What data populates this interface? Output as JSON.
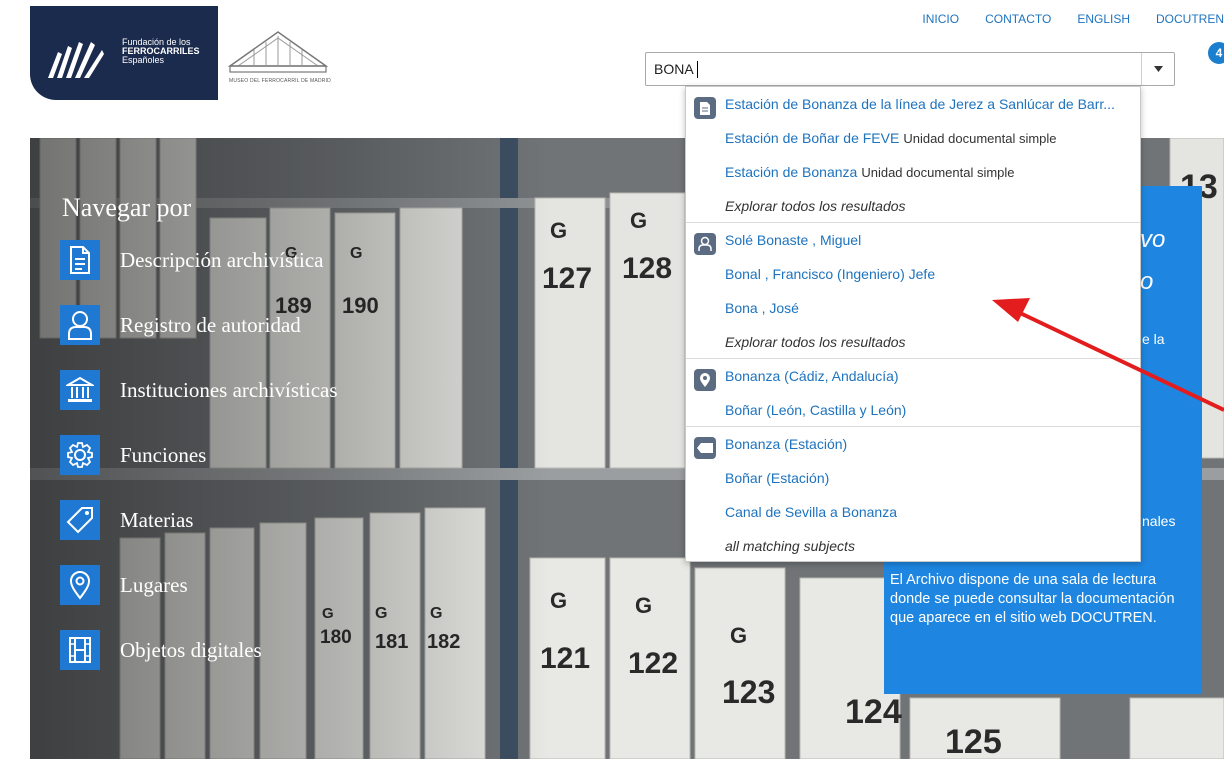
{
  "header": {
    "logo_line1": "Fundación de los",
    "logo_line2": "FERROCARRILES",
    "logo_line3": "Españoles",
    "museum_caption": "MUSEO DEL FERROCARRIL DE MADRID",
    "nav": [
      "INICIO",
      "CONTACTO",
      "ENGLISH",
      "DOCUTREN"
    ],
    "badge": "4"
  },
  "search": {
    "value": "BONA"
  },
  "autocomplete": {
    "descriptions": {
      "icon": "document-icon",
      "items": [
        {
          "title": "Estación de Bonanza de la línea de Jerez a Sanlúcar de Barr...",
          "meta": ""
        },
        {
          "title": "Estación de Boñar de FEVE",
          "meta": "Unidad documental simple"
        },
        {
          "title": "Estación de Bonanza",
          "meta": "Unidad documental simple"
        }
      ],
      "explore": "Explorar todos los resultados"
    },
    "authorities": {
      "icon": "person-icon",
      "items": [
        "Solé Bonaste , Miguel",
        "Bonal , Francisco (Ingeniero) Jefe",
        "Bona , José"
      ],
      "explore": "Explorar todos los resultados"
    },
    "places": {
      "icon": "map-pin-icon",
      "items": [
        "Bonanza (Cádiz, Andalucía)",
        "Boñar (León, Castilla y León)"
      ]
    },
    "subjects": {
      "icon": "tag-icon",
      "items": [
        "Bonanza (Estación)",
        "Boñar (Estación)",
        "Canal de Sevilla a Bonanza"
      ],
      "explore": "all matching subjects"
    }
  },
  "browse": {
    "title": "Navegar por",
    "items": [
      {
        "label": "Descripción archivística",
        "icon": "document-icon"
      },
      {
        "label": "Registro de autoridad",
        "icon": "person-icon"
      },
      {
        "label": "Instituciones archivísticas",
        "icon": "institution-icon"
      },
      {
        "label": "Funciones",
        "icon": "gear-icon"
      },
      {
        "label": "Materias",
        "icon": "tag-icon"
      },
      {
        "label": "Lugares",
        "icon": "map-pin-icon"
      },
      {
        "label": "Objetos digitales",
        "icon": "film-icon"
      }
    ]
  },
  "info": {
    "frag1": "vo",
    "frag2": "o",
    "frag3": "e la",
    "frag4": "nales",
    "text": "El Archivo dispone de una sala de lectura donde se puede consultar la documentación que aparece en el sitio web DOCUTREN."
  },
  "colors": {
    "brand_dark": "#1b2b4e",
    "accent_blue": "#1e86e0",
    "link_blue": "#1e73be",
    "arrow_red": "#e31d1d"
  }
}
